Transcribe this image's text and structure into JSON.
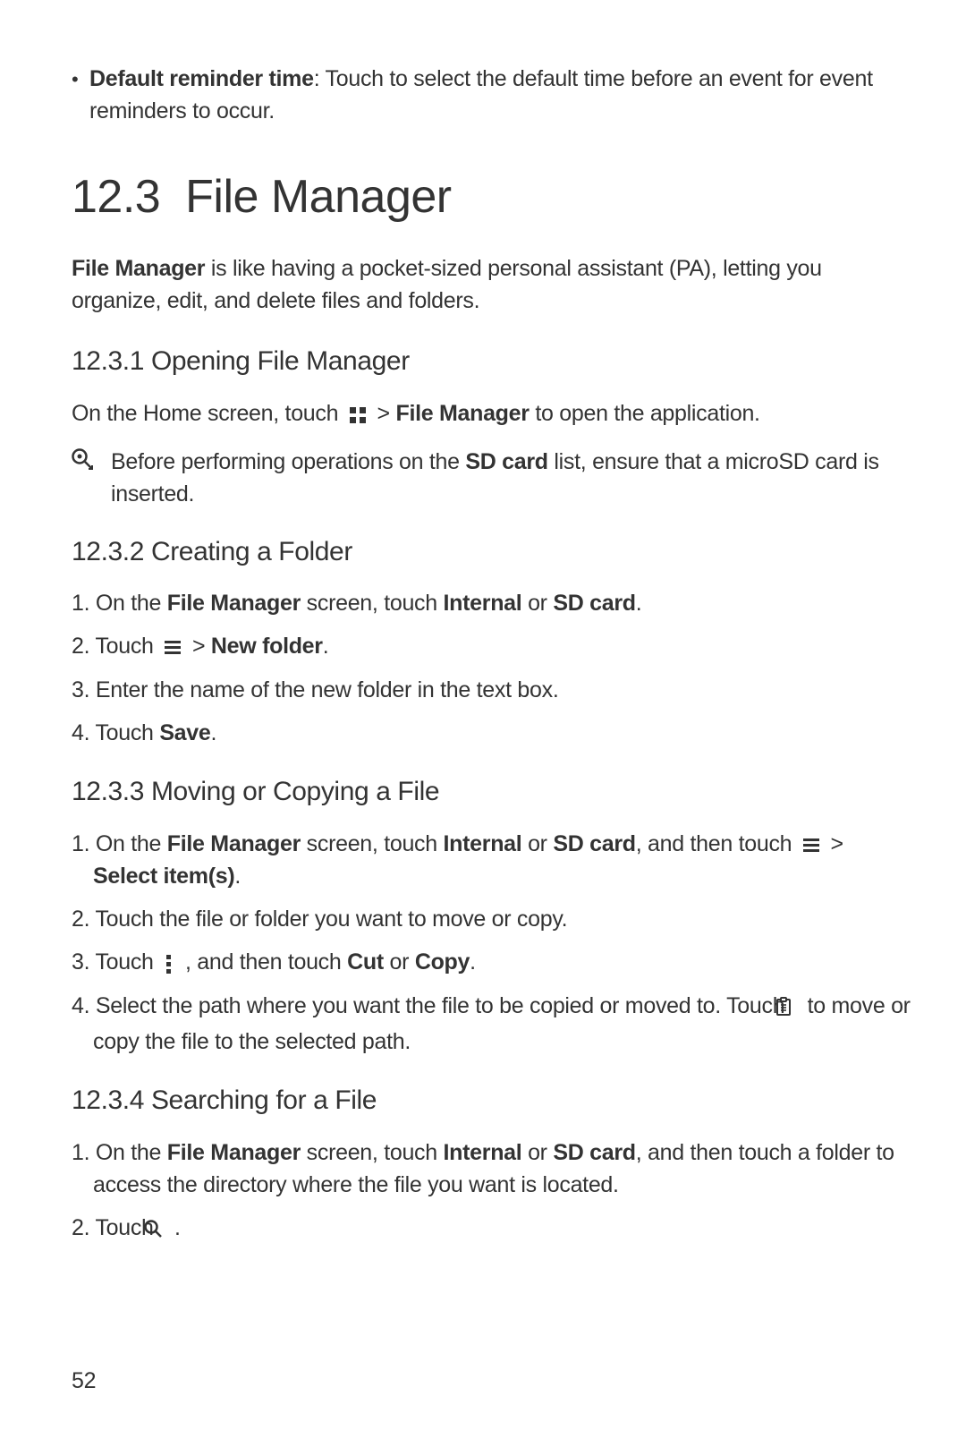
{
  "top_bullet": {
    "label": "Default reminder time",
    "desc": ": Touch to select the default time before an event for event reminders to occur."
  },
  "section": {
    "number": "12.3",
    "title": "File Manager"
  },
  "intro": {
    "em": "File Manager",
    "rest": " is like having a pocket-sized personal assistant (PA), letting you organize, edit, and delete files and folders."
  },
  "sub1": {
    "heading": "12.3.1  Opening File Manager",
    "line_prefix": "On the Home screen, touch ",
    "line_mid": " > ",
    "line_bold": "File Manager",
    "line_suffix": " to open the application.",
    "note_prefix": "Before performing operations on the ",
    "note_bold": "SD card",
    "note_suffix": " list, ensure that a microSD card is inserted."
  },
  "sub2": {
    "heading": "12.3.2  Creating a Folder",
    "s1_a": "1. On the ",
    "s1_b": "File Manager",
    "s1_c": " screen, touch ",
    "s1_d": "Internal",
    "s1_e": " or ",
    "s1_f": "SD card",
    "s1_g": ".",
    "s2_a": "2. Touch ",
    "s2_b": " > ",
    "s2_c": "New folder",
    "s2_d": ".",
    "s3": "3. Enter the name of the new folder in the text box.",
    "s4_a": "4. Touch ",
    "s4_b": "Save",
    "s4_c": "."
  },
  "sub3": {
    "heading": "12.3.3  Moving or Copying a File",
    "s1_a": "1. On the ",
    "s1_b": "File Manager",
    "s1_c": " screen, touch ",
    "s1_d": "Internal",
    "s1_e": " or ",
    "s1_f": "SD card",
    "s1_g": ", and then touch ",
    "s1_h": " > ",
    "s1_i": "Select item(s)",
    "s1_j": ".",
    "s2": "2. Touch the file or folder you want to move or copy.",
    "s3_a": "3. Touch ",
    "s3_b": " , and then touch ",
    "s3_c": "Cut",
    "s3_d": " or ",
    "s3_e": "Copy",
    "s3_f": ".",
    "s4_a": "4. Select the path where you want the file to be copied or moved to. Touch ",
    "s4_b": " to move or copy the file to the selected path."
  },
  "sub4": {
    "heading": "12.3.4  Searching for a File",
    "s1_a": "1. On the ",
    "s1_b": "File Manager",
    "s1_c": " screen, touch ",
    "s1_d": "Internal",
    "s1_e": " or ",
    "s1_f": "SD card",
    "s1_g": ", and then touch a folder to access the directory where the file you want is located.",
    "s2_a": "2. Touch ",
    "s2_b": " ."
  },
  "pagenum": "52"
}
